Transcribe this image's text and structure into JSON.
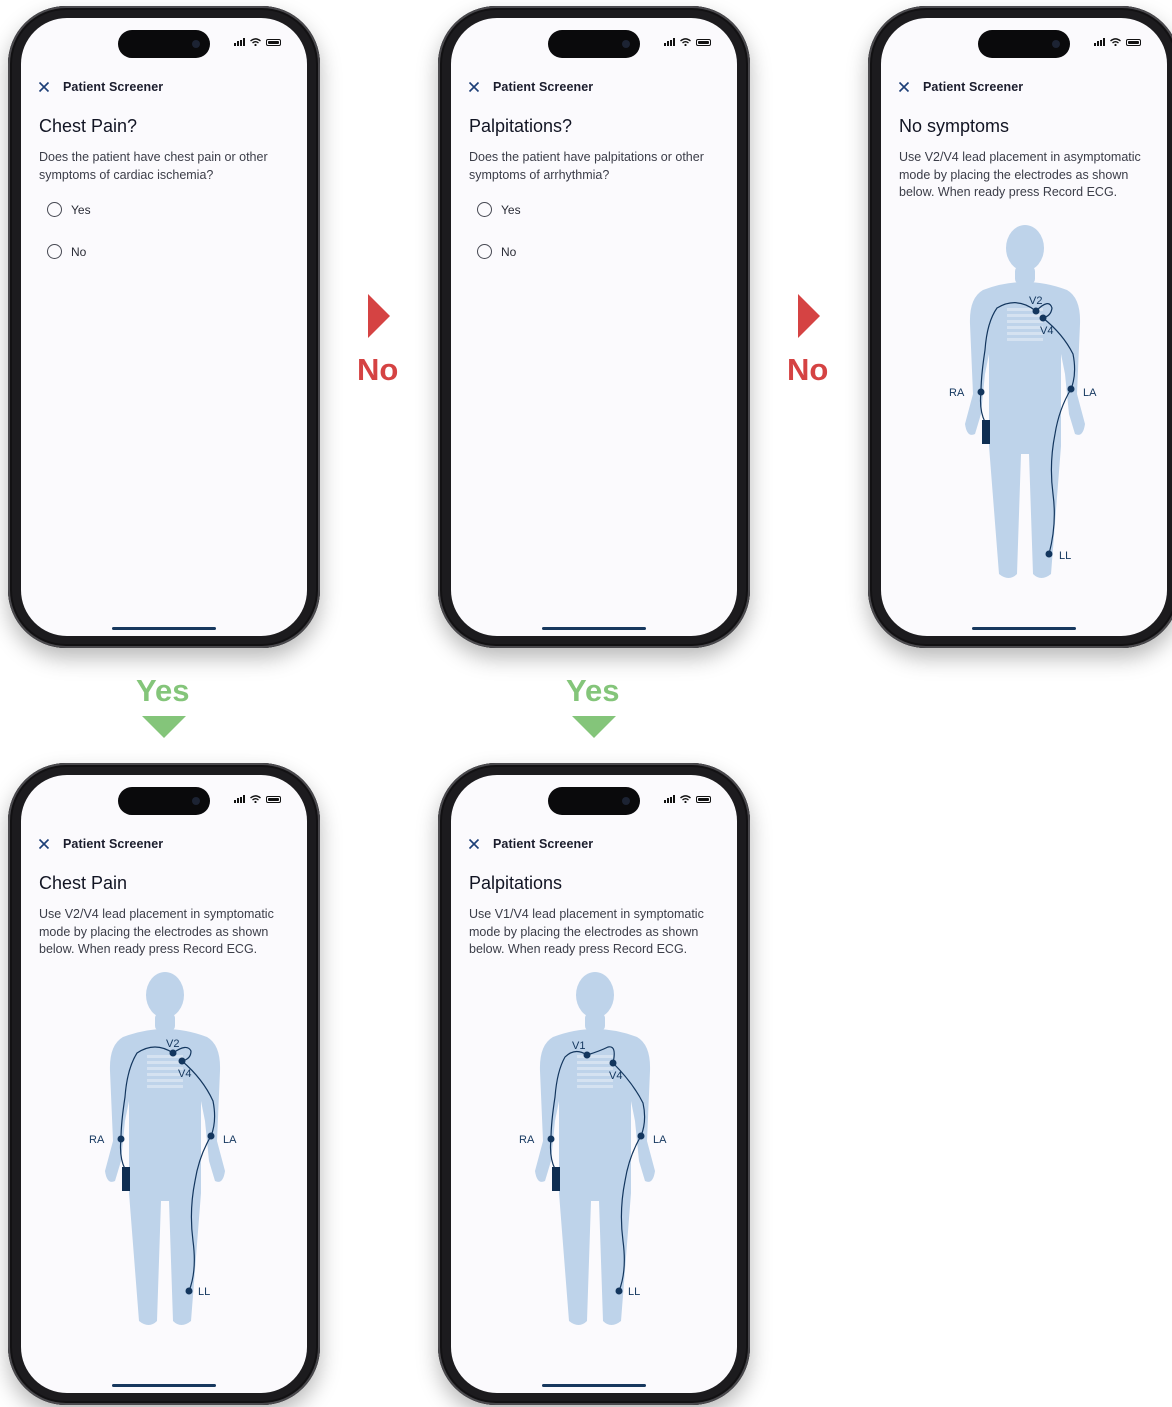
{
  "screens": {
    "chest_q": {
      "header": "Patient Screener",
      "title": "Chest Pain?",
      "text": "Does the patient have chest pain or other symptoms of cardiac ischemia?",
      "options": [
        "Yes",
        "No"
      ]
    },
    "palp_q": {
      "header": "Patient Screener",
      "title": "Palpitations?",
      "text": "Does the patient have palpitations or other symptoms of arrhythmia?",
      "options": [
        "Yes",
        "No"
      ]
    },
    "no_symptoms": {
      "header": "Patient Screener",
      "title": "No symptoms",
      "text": "Use V2/V4 lead placement in asymptomatic mode by placing the electrodes as shown below. When ready press Record ECG.",
      "leads": {
        "chest1": "V2",
        "chest2": "V4",
        "ra": "RA",
        "la": "LA",
        "ll": "LL"
      }
    },
    "chest_pain": {
      "header": "Patient Screener",
      "title": "Chest Pain",
      "text": "Use V2/V4 lead placement in symptomatic mode by placing the electrodes as shown below. When ready press Record ECG.",
      "leads": {
        "chest1": "V2",
        "chest2": "V4",
        "ra": "RA",
        "la": "LA",
        "ll": "LL"
      }
    },
    "palpitations": {
      "header": "Patient Screener",
      "title": "Palpitations",
      "text": "Use V1/V4 lead placement in symptomatic mode by placing the electrodes as shown below. When ready press Record ECG.",
      "leads": {
        "chest1": "V1",
        "chest2": "V4",
        "ra": "RA",
        "la": "LA",
        "ll": "LL"
      }
    }
  },
  "flow": {
    "no_label": "No",
    "yes_label": "Yes"
  },
  "colors": {
    "no": "#d54343",
    "yes": "#84c57a",
    "body": "#bed3ea",
    "lead": "#13365e"
  },
  "icons": {
    "close": "close-icon",
    "signal": "signal-icon",
    "wifi": "wifi-icon",
    "battery": "battery-icon"
  }
}
